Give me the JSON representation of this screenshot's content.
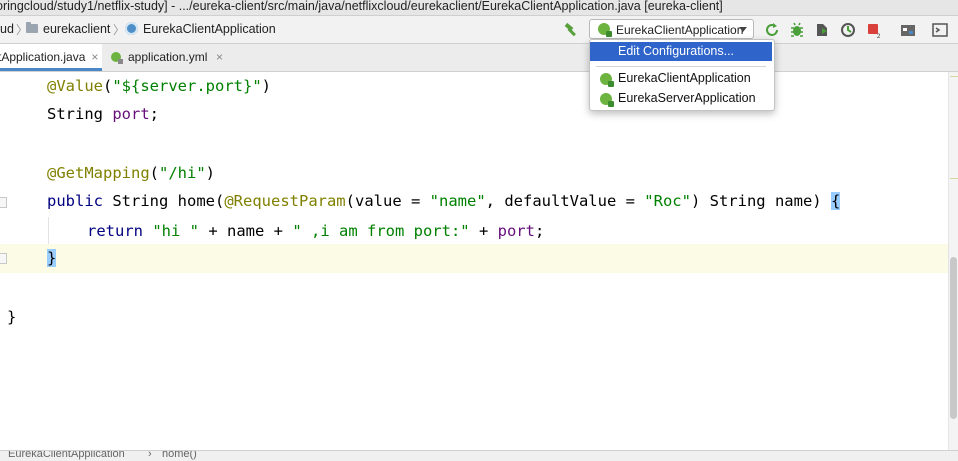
{
  "window": {
    "title": "oringcloud/study1/netflix-study] - .../eureka-client/src/main/java/netflixcloud/eurekaclient/EurekaClientApplication.java [eureka-client]"
  },
  "breadcrumb": {
    "items": [
      "ud",
      "eurekaclient",
      "EurekaClientApplication"
    ]
  },
  "run_config": {
    "selected": "EurekaClientApplication",
    "menu": {
      "edit": "Edit Configurations...",
      "items": [
        "EurekaClientApplication",
        "EurekaServerApplication"
      ]
    }
  },
  "tabs": [
    {
      "label": "tApplication.java",
      "active": true,
      "close": "×"
    },
    {
      "label": "application.yml",
      "active": false,
      "close": "×"
    }
  ],
  "code": {
    "l1": {
      "ann": "@Value",
      "p1": "(",
      "str": "\"${server.port}\"",
      "p2": ")"
    },
    "l2": {
      "type": "String ",
      "fld": "port",
      "semi": ";"
    },
    "l3": {
      "ann": "@GetMapping",
      "p1": "(",
      "str": "\"/hi\"",
      "p2": ")"
    },
    "l4": {
      "kw": "public",
      "a": " String home(",
      "ann": "@RequestParam",
      "b": "(value = ",
      "s1": "\"name\"",
      "c": ", defaultValue = ",
      "s2": "\"Roc\"",
      "d": ") String name) ",
      "brace": "{"
    },
    "l5": {
      "kw": "return ",
      "s1": "\"hi \"",
      "a": " + name + ",
      "s2": "\" ,i am from port:\"",
      "b": " + ",
      "fld": "port",
      "semi": ";"
    },
    "l6": {
      "brace": "}"
    },
    "l7": {
      "brace": "}"
    }
  },
  "status": {
    "path": [
      "EurekaClientApplication",
      "home()"
    ],
    "sep": "›"
  },
  "icons": {
    "hammer": "build-hammer-icon",
    "rerun": "rerun-icon",
    "debug": "debug-bug-icon",
    "coverage": "coverage-icon",
    "profile": "profile-icon",
    "stop": "stop-icon",
    "structure": "project-structure-icon",
    "terminal": "terminal-icon"
  },
  "colors": {
    "keyword": "#000080",
    "annotation": "#808000",
    "string": "#008000",
    "field": "#660e7a",
    "selection": "#2f65ca",
    "brace_highlight": "#99ccff"
  }
}
